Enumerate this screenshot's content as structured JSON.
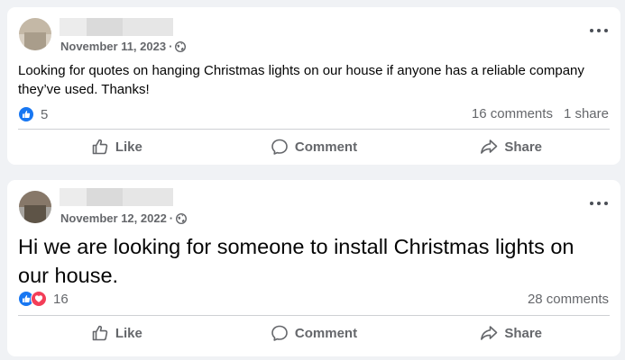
{
  "colors": {
    "page_bg": "#f0f2f5",
    "card_bg": "#ffffff",
    "secondary_text": "#65676b",
    "like_blue": "#1877f2",
    "love_red": "#f33e58"
  },
  "posts": [
    {
      "date": "November 11, 2023",
      "separator": "·",
      "privacy_icon": "globe-icon",
      "text": "Looking for quotes on hanging Christmas lights on our house if anyone has a reliable company they’ve used. Thanks!",
      "reactions": [
        "like-reaction-icon"
      ],
      "reaction_count": "5",
      "comments": "16 comments",
      "shares": "1 share",
      "actions": {
        "like": "Like",
        "comment": "Comment",
        "share": "Share"
      }
    },
    {
      "date": "November 12, 2022",
      "separator": "·",
      "privacy_icon": "globe-icon",
      "text": "Hi we are looking for someone to install Christmas lights on our house.",
      "reactions": [
        "like-reaction-icon",
        "love-reaction-icon"
      ],
      "reaction_count": "16",
      "comments": "28 comments",
      "actions": {
        "like": "Like",
        "comment": "Comment",
        "share": "Share"
      }
    }
  ]
}
